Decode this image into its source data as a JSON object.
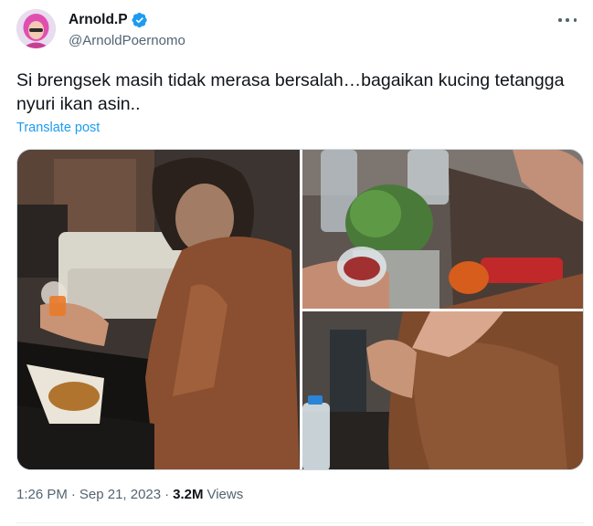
{
  "author": {
    "display_name": "Arnold.P",
    "handle": "@ArnoldPoernomo",
    "verified": true,
    "avatar_icon": "avatar-icon"
  },
  "post": {
    "text": "Si brengsek masih tidak merasa bersalah…bagaikan kucing tetangga nyuri ikan asin..",
    "translate_label": "Translate post",
    "media_count": 3
  },
  "meta": {
    "time": "1:26 PM",
    "date": "Sep 21, 2023",
    "separator": "·",
    "views_count": "3.2M",
    "views_label": "Views"
  },
  "colors": {
    "link": "#1d9bf0",
    "verified": "#1d9bf0",
    "secondary_text": "#536471",
    "primary_text": "#0f1419"
  }
}
